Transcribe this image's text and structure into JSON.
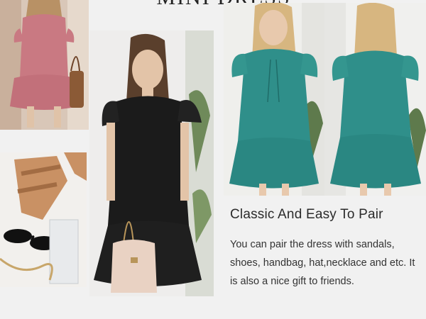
{
  "header": {
    "title": "MINI DRESS"
  },
  "images": [
    {
      "name": "pink-dress-photo",
      "subject": "pink ruffle sleeve mini dress with brown handbag",
      "color": "#c97982"
    },
    {
      "name": "accessories-photo",
      "subject": "tan sandals, black sunglasses and gold chain",
      "color": "#c99164"
    },
    {
      "name": "black-dress-photo",
      "subject": "black ruffle sleeve mini dress with cream handbag",
      "color": "#1b1b1b"
    },
    {
      "name": "teal-dress-front-photo",
      "subject": "teal ruffle sleeve mini dress front view",
      "color": "#2f8f8a"
    },
    {
      "name": "teal-dress-back-photo",
      "subject": "teal ruffle sleeve mini dress back view",
      "color": "#2f8f8a"
    }
  ],
  "feature": {
    "heading": "Classic And Easy To Pair",
    "body": "You can pair the dress with sandals, shoes, handbag, hat,necklace and etc. It is also a nice gift to friends."
  }
}
